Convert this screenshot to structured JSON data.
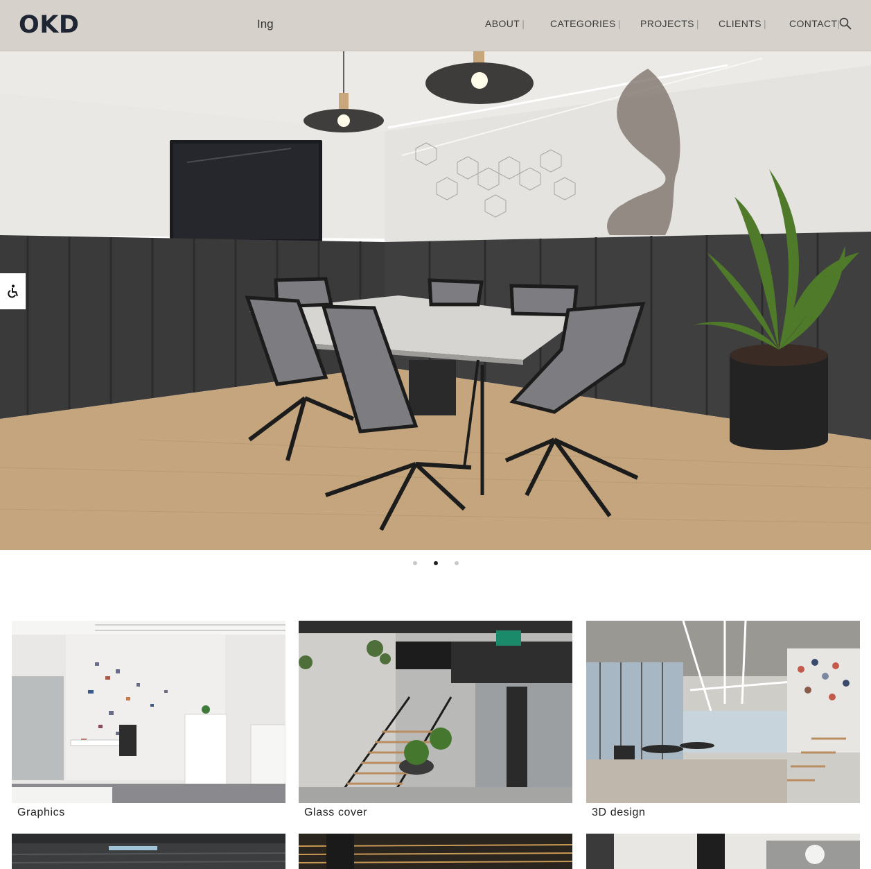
{
  "header": {
    "logo": "OKD",
    "lang": "Ing",
    "nav": [
      {
        "label": "ABOUT",
        "sep": "|"
      },
      {
        "label": "CATEGORIES",
        "sep": "|"
      },
      {
        "label": "PROJECTS",
        "sep": "|"
      },
      {
        "label": "CLIENTS",
        "sep": "|"
      },
      {
        "label": "CONTACT",
        "sep": "|"
      }
    ],
    "search_icon": "search-icon",
    "background": "#d6d2cb"
  },
  "hero": {
    "description_icon": "conference-room-photo",
    "slides_count": 3,
    "active_slide": 2
  },
  "accessibility": {
    "icon": "wheelchair-icon"
  },
  "categories": [
    {
      "caption": "Graphics"
    },
    {
      "caption": "Glass cover"
    },
    {
      "caption": "3D design"
    }
  ]
}
